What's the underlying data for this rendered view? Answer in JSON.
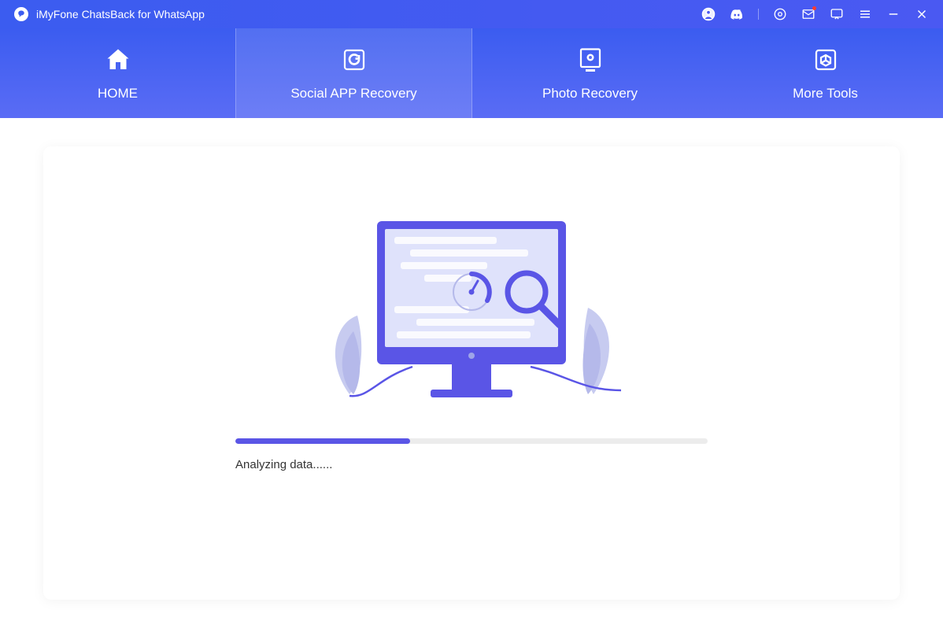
{
  "app": {
    "title": "iMyFone ChatsBack for WhatsApp"
  },
  "nav": {
    "items": [
      {
        "label": "HOME"
      },
      {
        "label": "Social APP Recovery"
      },
      {
        "label": "Photo Recovery"
      },
      {
        "label": "More Tools"
      }
    ],
    "activeIndex": 1
  },
  "main": {
    "status": "Analyzing data......",
    "progressPercent": 37
  },
  "colors": {
    "accent": "#5a55e6",
    "headerStart": "#3b5cf0",
    "headerEnd": "#5a6cf5"
  }
}
